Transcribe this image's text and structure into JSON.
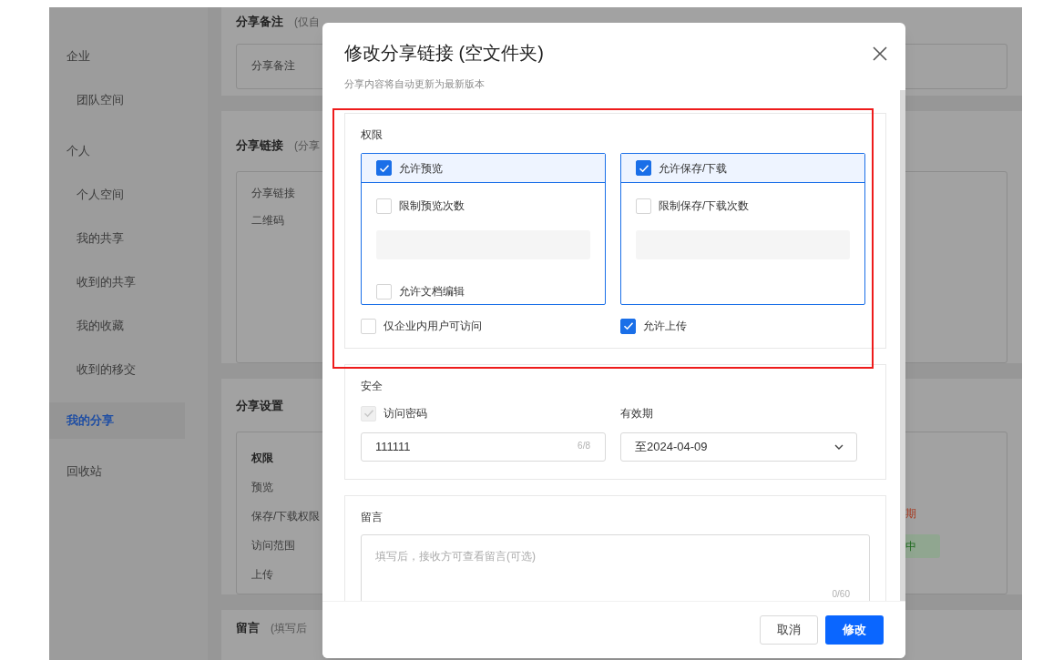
{
  "sidebar": {
    "items": [
      {
        "kind": "heading",
        "label": "企业",
        "selected": false
      },
      {
        "kind": "sub",
        "label": "团队空间",
        "selected": false
      },
      {
        "kind": "heading",
        "label": "个人",
        "selected": false
      },
      {
        "kind": "sub",
        "label": "个人空间",
        "selected": false
      },
      {
        "kind": "sub",
        "label": "我的共享",
        "selected": false
      },
      {
        "kind": "sub",
        "label": "收到的共享",
        "selected": false
      },
      {
        "kind": "sub",
        "label": "我的收藏",
        "selected": false
      },
      {
        "kind": "sub",
        "label": "收到的移交",
        "selected": false
      },
      {
        "kind": "top",
        "label": "我的分享",
        "selected": true
      },
      {
        "kind": "top",
        "label": "回收站",
        "selected": false
      }
    ]
  },
  "background": {
    "cards": [
      {
        "kind": "note",
        "title": "分享备注",
        "note": "(仅自",
        "rows": [
          {
            "label": "分享备注",
            "bold": false
          }
        ]
      },
      {
        "kind": "link",
        "title": "分享链接",
        "note": "(分享",
        "rows": [
          {
            "label": "分享链接",
            "bold": false
          },
          {
            "label": "二维码",
            "bold": false
          }
        ]
      },
      {
        "kind": "settings",
        "title": "分享设置",
        "rows": [
          {
            "label": "权限",
            "bold": true
          },
          {
            "label": "预览",
            "bold": false
          },
          {
            "label": "保存/下载权限",
            "bold": false
          },
          {
            "label": "访问范围",
            "bold": false
          },
          {
            "label": "上传",
            "bold": false
          }
        ],
        "side_texts": [
          {
            "kind": "warning",
            "text": "期"
          },
          {
            "kind": "tag",
            "text": "中"
          }
        ]
      },
      {
        "kind": "message",
        "title": "留言",
        "note": "(填写后"
      }
    ]
  },
  "dialog": {
    "title": "修改分享链接 (空文件夹)",
    "subtitle": "分享内容将自动更新为最新版本",
    "permissions": {
      "title": "权限",
      "panels": [
        {
          "label": "允许预览",
          "checked": true,
          "options": [
            {
              "kind": "checkbox",
              "label": "限制预览次数",
              "checked": false
            },
            {
              "kind": "count_field",
              "disabled": true
            },
            {
              "kind": "checkbox",
              "label": "允许文档编辑",
              "checked": false
            }
          ]
        },
        {
          "label": "允许保存/下载",
          "checked": true,
          "options": [
            {
              "kind": "checkbox",
              "label": "限制保存/下载次数",
              "checked": false
            },
            {
              "kind": "count_field",
              "disabled": true
            }
          ]
        }
      ],
      "options": [
        {
          "label": "仅企业内用户可访问",
          "checked": false
        },
        {
          "label": "允许上传",
          "checked": true
        }
      ]
    },
    "security": {
      "title": "安全",
      "password": {
        "label": "访问密码",
        "checked": true,
        "disabled": true,
        "value": "111111",
        "counter": "6/8"
      },
      "expiry": {
        "label": "有效期",
        "value": "至2024-04-09"
      }
    },
    "message": {
      "title": "留言",
      "placeholder": "填写后，接收方可查看留言(可选)",
      "counter": "0/60"
    },
    "buttons": [
      {
        "label": "取消",
        "kind": "secondary"
      },
      {
        "label": "修改",
        "kind": "primary"
      }
    ]
  }
}
